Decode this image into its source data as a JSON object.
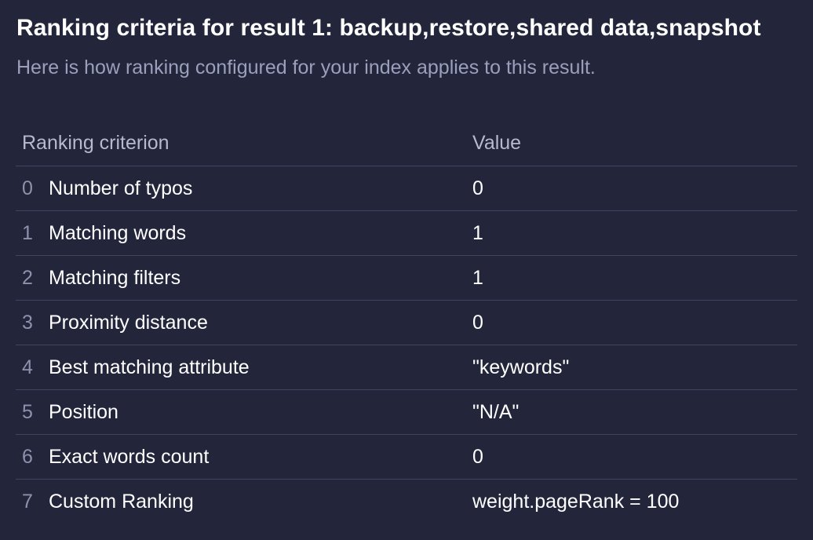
{
  "title": "Ranking criteria for result 1: backup,restore,shared data,snapshot",
  "subtitle": "Here is how ranking configured for your index applies to this result.",
  "table": {
    "headers": {
      "criterion": "Ranking criterion",
      "value": "Value"
    },
    "rows": [
      {
        "index": "0",
        "criterion": "Number of typos",
        "value": "0"
      },
      {
        "index": "1",
        "criterion": "Matching words",
        "value": "1"
      },
      {
        "index": "2",
        "criterion": "Matching filters",
        "value": "1"
      },
      {
        "index": "3",
        "criterion": "Proximity distance",
        "value": "0"
      },
      {
        "index": "4",
        "criterion": "Best matching attribute",
        "value": "\"keywords\""
      },
      {
        "index": "5",
        "criterion": "Position",
        "value": "\"N/A\""
      },
      {
        "index": "6",
        "criterion": "Exact words count",
        "value": "0"
      },
      {
        "index": "7",
        "criterion": "Custom Ranking",
        "value": "weight.pageRank = 100"
      }
    ]
  },
  "colors": {
    "background": "#23263b",
    "text": "#ffffff",
    "muted": "#9b9fbb",
    "divider": "#3f4462"
  }
}
